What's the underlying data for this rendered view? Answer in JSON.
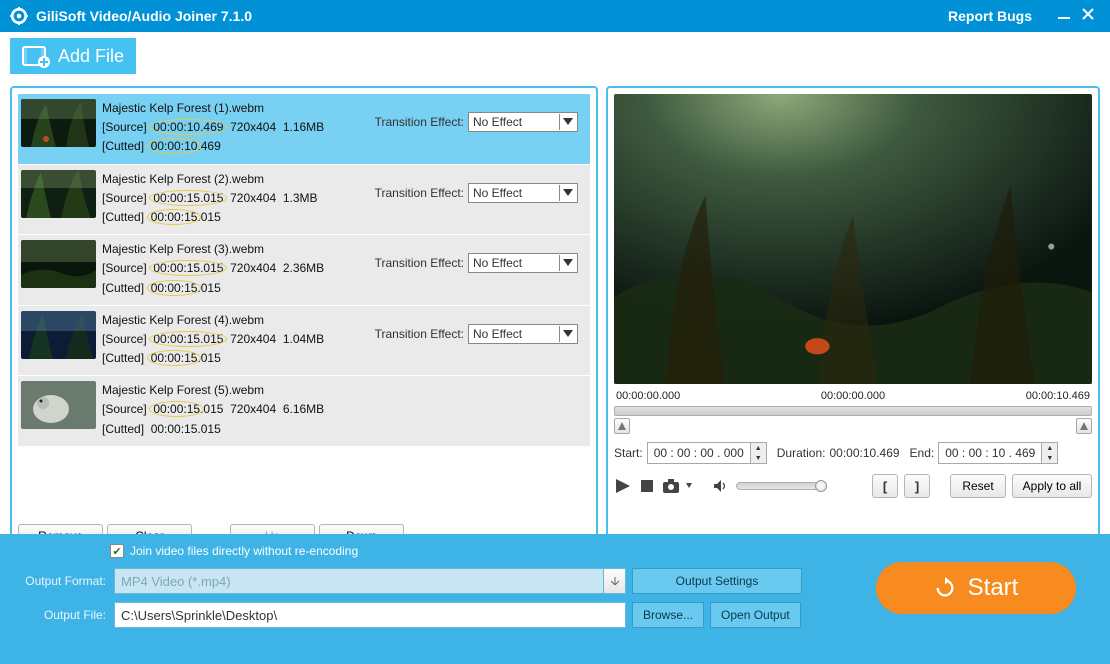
{
  "app": {
    "title": "GiliSoft Video/Audio Joiner 7.1.0",
    "report_bugs": "Report Bugs"
  },
  "toolbar": {
    "add_file": "Add File"
  },
  "files": [
    {
      "name": "Majestic Kelp Forest (1).webm",
      "source_label": "[Source]",
      "source_time": "00:00:10.469",
      "resolution": "720x404",
      "size": "1.16MB",
      "cutted_label": "[Cutted]",
      "cutted_time": "00:00:10",
      "cutted_ms": "469",
      "show_effect": true,
      "selected": true
    },
    {
      "name": "Majestic Kelp Forest (2).webm",
      "source_label": "[Source]",
      "source_time": "00:00:15.015",
      "resolution": "720x404",
      "size": "1.3MB",
      "cutted_label": "[Cutted]",
      "cutted_time": "00:00:15",
      "cutted_ms": "015",
      "show_effect": true,
      "selected": false
    },
    {
      "name": "Majestic Kelp Forest (3).webm",
      "source_label": "[Source]",
      "source_time": "00:00:15.015",
      "resolution": "720x404",
      "size": "2.36MB",
      "cutted_label": "[Cutted]",
      "cutted_time": "00:00:15",
      "cutted_ms": "015",
      "show_effect": true,
      "selected": false
    },
    {
      "name": "Majestic Kelp Forest (4).webm",
      "source_label": "[Source]",
      "source_time": "00:00:15.015",
      "resolution": "720x404",
      "size": "1.04MB",
      "cutted_label": "[Cutted]",
      "cutted_time": "00:00:15",
      "cutted_ms": "015",
      "show_effect": true,
      "selected": false
    },
    {
      "name": "Majestic Kelp Forest (5).webm",
      "source_label": "[Source]",
      "source_time": "00:00:15",
      "src_ms": "015",
      "resolution": "720x404",
      "size": "6.16MB",
      "cutted_label": "[Cutted]",
      "cutted_time_full": "00:00:15.015",
      "show_effect": false,
      "selected": false
    }
  ],
  "transition": {
    "label": "Transition Effect:",
    "value": "No Effect"
  },
  "list_buttons": {
    "remove": "Remove",
    "clear": "Clear",
    "up": "Up",
    "down": "Down"
  },
  "preview": {
    "time_start": "00:00:00.000",
    "time_mid": "00:00:00.000",
    "time_end": "00:00:10.469",
    "start_label": "Start:",
    "start_value": "00 : 00 : 00 . 000",
    "duration_label": "Duration:",
    "duration_value": "00:00:10.469",
    "end_label": "End:",
    "end_value": "00 : 00 : 10 . 469",
    "reset": "Reset",
    "apply_all": "Apply to all"
  },
  "bottom": {
    "join_without_reencode": "Join video files directly without re-encoding",
    "output_format_label": "Output Format:",
    "output_format_value": "MP4 Video (*.mp4)",
    "output_settings": "Output Settings",
    "output_file_label": "Output File:",
    "output_file_value": "C:\\Users\\Sprinkle\\Desktop\\",
    "browse": "Browse...",
    "open_output": "Open Output",
    "start": "Start"
  }
}
